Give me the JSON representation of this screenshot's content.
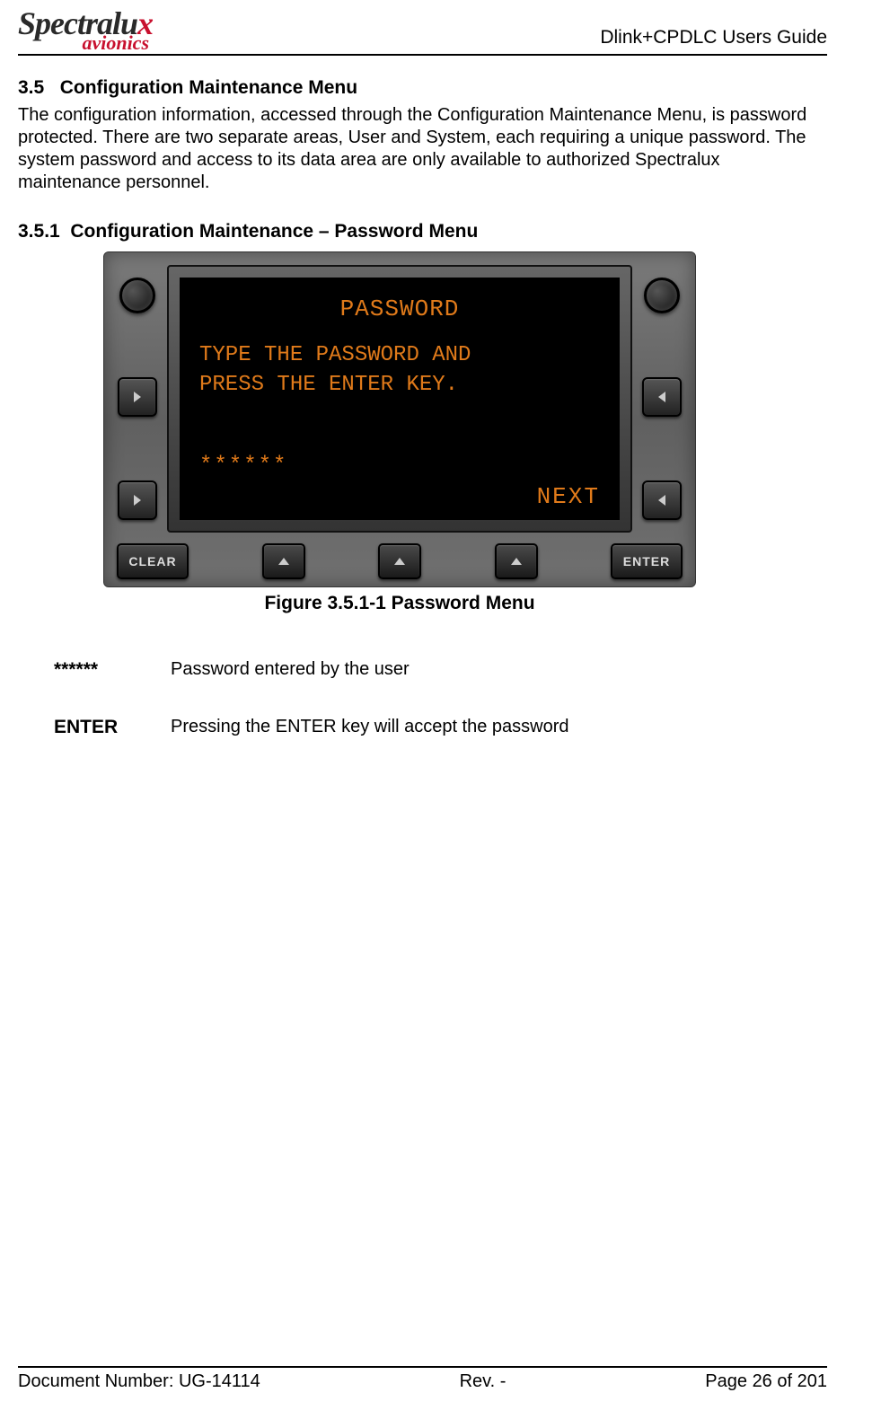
{
  "header": {
    "logo_main": "Spectralu",
    "logo_x": "x",
    "logo_sub": "avionics",
    "doc_title": "Dlink+CPDLC Users Guide"
  },
  "section": {
    "num": "3.5",
    "title": "Configuration Maintenance Menu",
    "body": "The configuration information, accessed through the Configuration Maintenance Menu, is password protected.  There are two separate areas, User and System, each requiring a unique password.  The system password and access to its data area are only available to authorized Spectralux maintenance personnel."
  },
  "subsection": {
    "num": "3.5.1",
    "title": "Configuration Maintenance – Password Menu"
  },
  "device": {
    "screen_title": "PASSWORD",
    "line1": "TYPE THE PASSWORD AND",
    "line2": "PRESS THE ENTER KEY.",
    "stars": "******",
    "next": "NEXT",
    "clear_btn": "CLEAR",
    "enter_btn": "ENTER"
  },
  "figure_caption": "Figure 3.5.1-1 Password Menu",
  "definitions": [
    {
      "term": "******",
      "desc": "Password entered by the user"
    },
    {
      "term": "ENTER",
      "desc": "Pressing the ENTER key will accept the password"
    }
  ],
  "footer": {
    "left": "Document Number:  UG-14114",
    "center": "Rev. -",
    "right": "Page 26 of 201"
  }
}
